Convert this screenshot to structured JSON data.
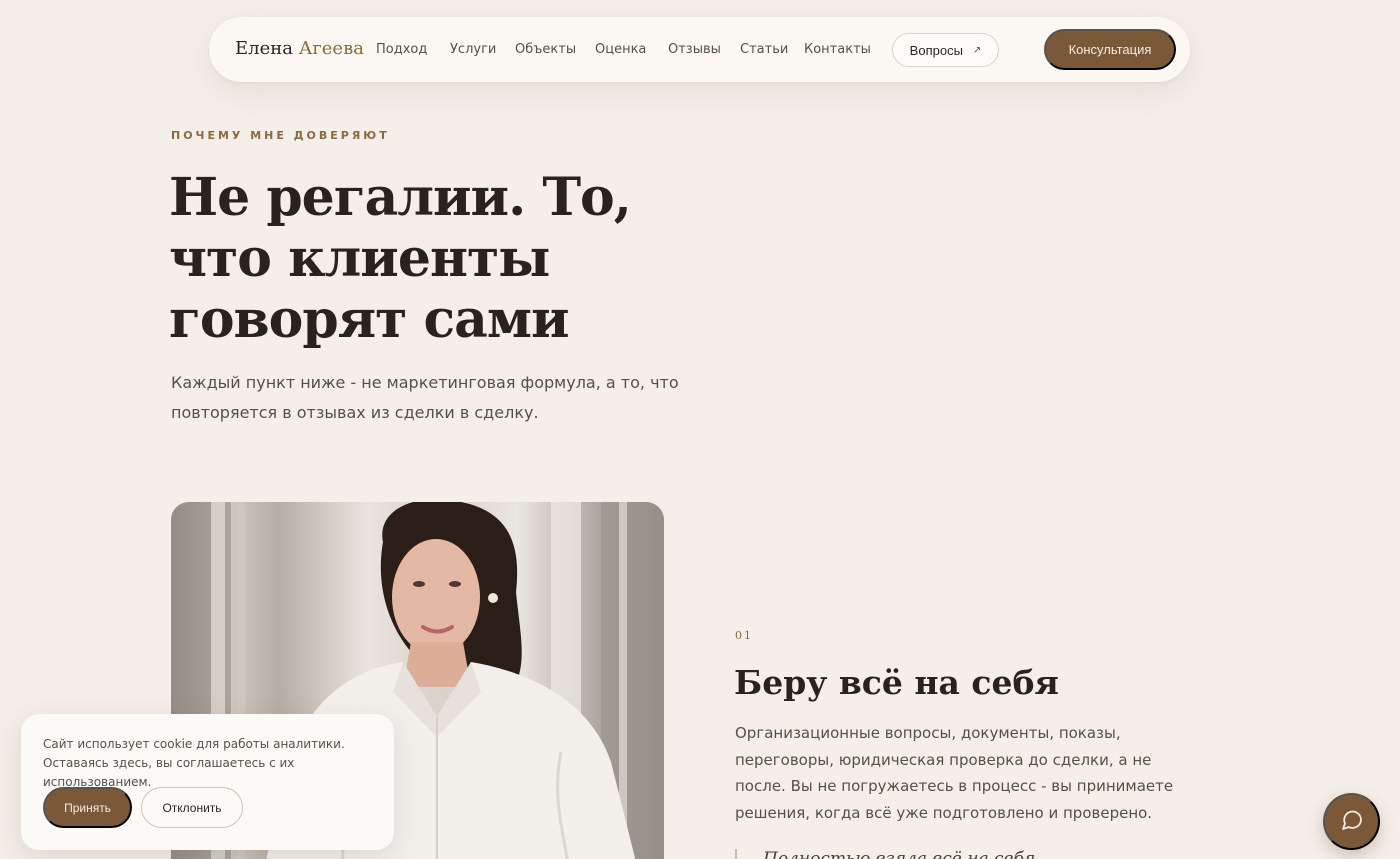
{
  "header": {
    "logo_first": "Елена",
    "logo_second": "Агеева",
    "nav": [
      "Подход",
      "Услуги",
      "Объекты",
      "Оценка",
      "Отзывы",
      "Статьи",
      "Контакты"
    ],
    "faq_label": "Вопросы",
    "faq_arrow": "↗",
    "cta_label": "Консультация"
  },
  "hero": {
    "eyebrow": "ПОЧЕМУ МНЕ ДОВЕРЯЮТ",
    "title_lines": [
      "Не регалии. То,",
      "что клиенты",
      "говорят сами"
    ],
    "subtitle": "Каждый пункт ниже - не маркетинговая формула, а то, что повторяется в отзывах из сделки в сделку."
  },
  "feature": {
    "number": "01",
    "title": "Беру всё на себя",
    "text": "Организационные вопросы, документы, показы, переговоры, юридическая проверка до сделки, а не после. Вы не погружаетесь в процесс - вы принимаете решения, когда всё уже подготовлено и проверено.",
    "quote": "Полностью взяла всё на себя"
  },
  "cookie": {
    "text": "Сайт использует cookie для работы аналитики. Оставаясь здесь, вы соглашаетесь с их использованием.",
    "accept_label": "Принять",
    "decline_label": "Отклонить"
  },
  "colors": {
    "background": "#f5efe9",
    "accent": "#7a5838",
    "eyebrow": "#8a6a3f",
    "text": "#2a221d"
  },
  "icons": {
    "chat": "chat-bubble-icon",
    "faq_arrow": "arrow-up-right-icon"
  }
}
